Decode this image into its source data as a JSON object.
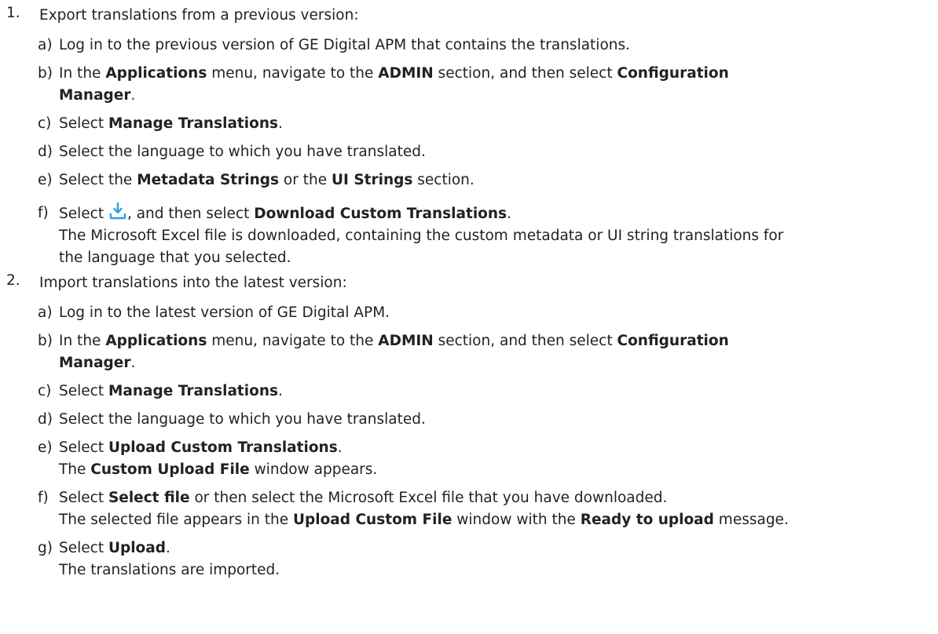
{
  "steps": [
    {
      "num": "1.",
      "text": "Export translations from a previous version:",
      "substeps": [
        {
          "letter": "a)",
          "parts": [
            "Log in to the previous version of GE Digital APM that contains the translations."
          ]
        },
        {
          "letter": "b)",
          "parts": [
            "In the ",
            "Applications",
            " menu, navigate to the ",
            "ADMIN",
            " section, and then select ",
            "Configuration",
            "Manager",
            "."
          ]
        },
        {
          "letter": "c)",
          "parts": [
            "Select ",
            "Manage Translations",
            "."
          ]
        },
        {
          "letter": "d)",
          "parts": [
            "Select the language to which you have translated."
          ]
        },
        {
          "letter": "e)",
          "parts": [
            "Select the ",
            "Metadata Strings",
            " or the ",
            "UI Strings",
            " section."
          ]
        },
        {
          "letter": "f)",
          "parts": [
            "Select ",
            ", and then select ",
            "Download Custom Translations",
            "."
          ],
          "icon": "download-icon",
          "result": [
            "The Microsoft Excel file is downloaded, containing the custom metadata or UI string translations for",
            "the language that you selected."
          ]
        }
      ]
    },
    {
      "num": "2.",
      "text": "Import translations into the latest version:",
      "substeps": [
        {
          "letter": "a)",
          "parts": [
            "Log in to the latest version of GE Digital APM."
          ]
        },
        {
          "letter": "b)",
          "parts": [
            "In the ",
            "Applications",
            " menu, navigate to the ",
            "ADMIN",
            " section, and then select ",
            "Configuration",
            "Manager",
            "."
          ]
        },
        {
          "letter": "c)",
          "parts": [
            "Select ",
            "Manage Translations",
            "."
          ]
        },
        {
          "letter": "d)",
          "parts": [
            "Select the language to which you have translated."
          ]
        },
        {
          "letter": "e)",
          "parts": [
            "Select ",
            "Upload Custom Translations",
            "."
          ],
          "result": [
            "The ",
            "Custom Upload File",
            " window appears."
          ]
        },
        {
          "letter": "f)",
          "parts": [
            "Select ",
            "Select file",
            " or then select the Microsoft Excel file that you have downloaded."
          ],
          "result": [
            "The selected file appears in the ",
            "Upload Custom File",
            " window with the ",
            "Ready to upload",
            " message."
          ]
        },
        {
          "letter": "g)",
          "parts": [
            "Select ",
            "Upload",
            "."
          ],
          "result": [
            "The translations are imported."
          ]
        }
      ]
    }
  ],
  "colors": {
    "text": "#222222",
    "icon_blue": "#29a3e0"
  }
}
